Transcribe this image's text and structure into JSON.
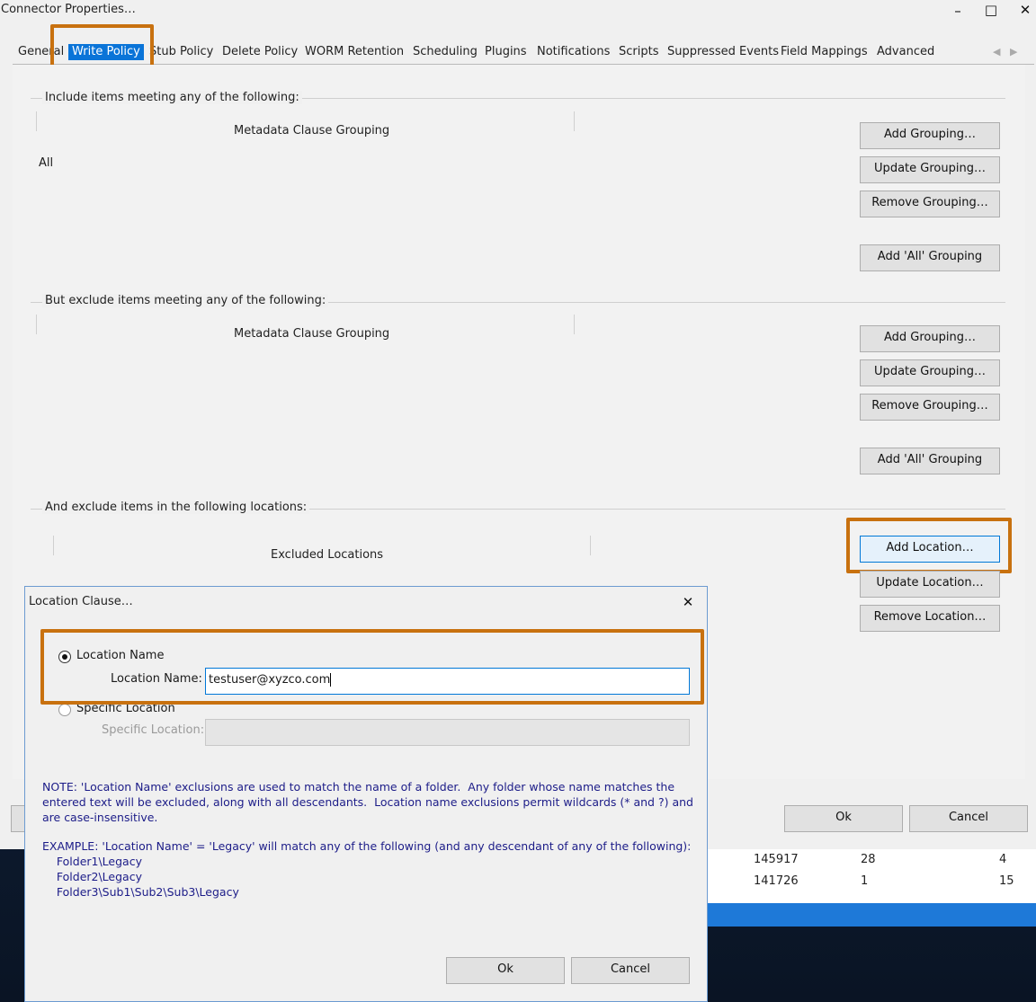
{
  "window": {
    "title": "Connector Properties…",
    "minimize": "–",
    "maximize": "□",
    "close": "✕"
  },
  "tabs": [
    {
      "label": "General"
    },
    {
      "label": "Write Policy",
      "active": true
    },
    {
      "label": "Stub Policy"
    },
    {
      "label": "Delete Policy"
    },
    {
      "label": "WORM Retention"
    },
    {
      "label": "Scheduling"
    },
    {
      "label": "Plugins"
    },
    {
      "label": "Notifications"
    },
    {
      "label": "Scripts"
    },
    {
      "label": "Suppressed Events"
    },
    {
      "label": "Field Mappings"
    },
    {
      "label": "Advanced"
    }
  ],
  "include_section": {
    "title": "Include items meeting any of the following:",
    "column_header": "Metadata Clause Grouping",
    "items": [
      "All"
    ],
    "buttons": {
      "add": "Add Grouping…",
      "update": "Update Grouping…",
      "remove": "Remove Grouping…",
      "add_all": "Add 'All' Grouping"
    }
  },
  "exclude_section": {
    "title": "But exclude items meeting any of the following:",
    "column_header": "Metadata Clause Grouping",
    "buttons": {
      "add": "Add Grouping…",
      "update": "Update Grouping…",
      "remove": "Remove Grouping…",
      "add_all": "Add 'All' Grouping"
    }
  },
  "location_section": {
    "title": "And exclude items in the following locations:",
    "column_header": "Excluded Locations",
    "buttons": {
      "add": "Add Location…",
      "update": "Update Location…",
      "remove": "Remove Location…"
    }
  },
  "footer_buttons": {
    "ok": "Ok",
    "cancel": "Cancel"
  },
  "background_table": {
    "rows": [
      [
        "145917",
        "28",
        "4"
      ],
      [
        "141726",
        "1",
        "15"
      ]
    ]
  },
  "dialog": {
    "title": "Location Clause…",
    "close": "✕",
    "option_location_name": "Location Name",
    "location_name_label": "Location Name:",
    "location_name_value": "testuser@xyzco.com",
    "option_specific_location": "Specific Location",
    "specific_location_label": "Specific Location:",
    "specific_location_value": "",
    "note_lines": [
      "NOTE: 'Location Name' exclusions are used to match the name of a folder.  Any folder whose name matches the",
      "entered text will be excluded, along with all descendants.  Location name exclusions permit wildcards (* and ?) and",
      "are case-insensitive."
    ],
    "example_lines": [
      "EXAMPLE: 'Location Name' = 'Legacy' will match any of the following (and any descendant of any of the following):",
      "    Folder1\\Legacy",
      "    Folder2\\Legacy",
      "    Folder3\\Sub1\\Sub2\\Sub3\\Legacy"
    ],
    "ok": "Ok",
    "cancel": "Cancel"
  },
  "colors": {
    "active_tab": "#0a74d8",
    "highlight_box": "#c8710f",
    "note_text": "#1c1c88",
    "focus_border": "#0078d7"
  }
}
